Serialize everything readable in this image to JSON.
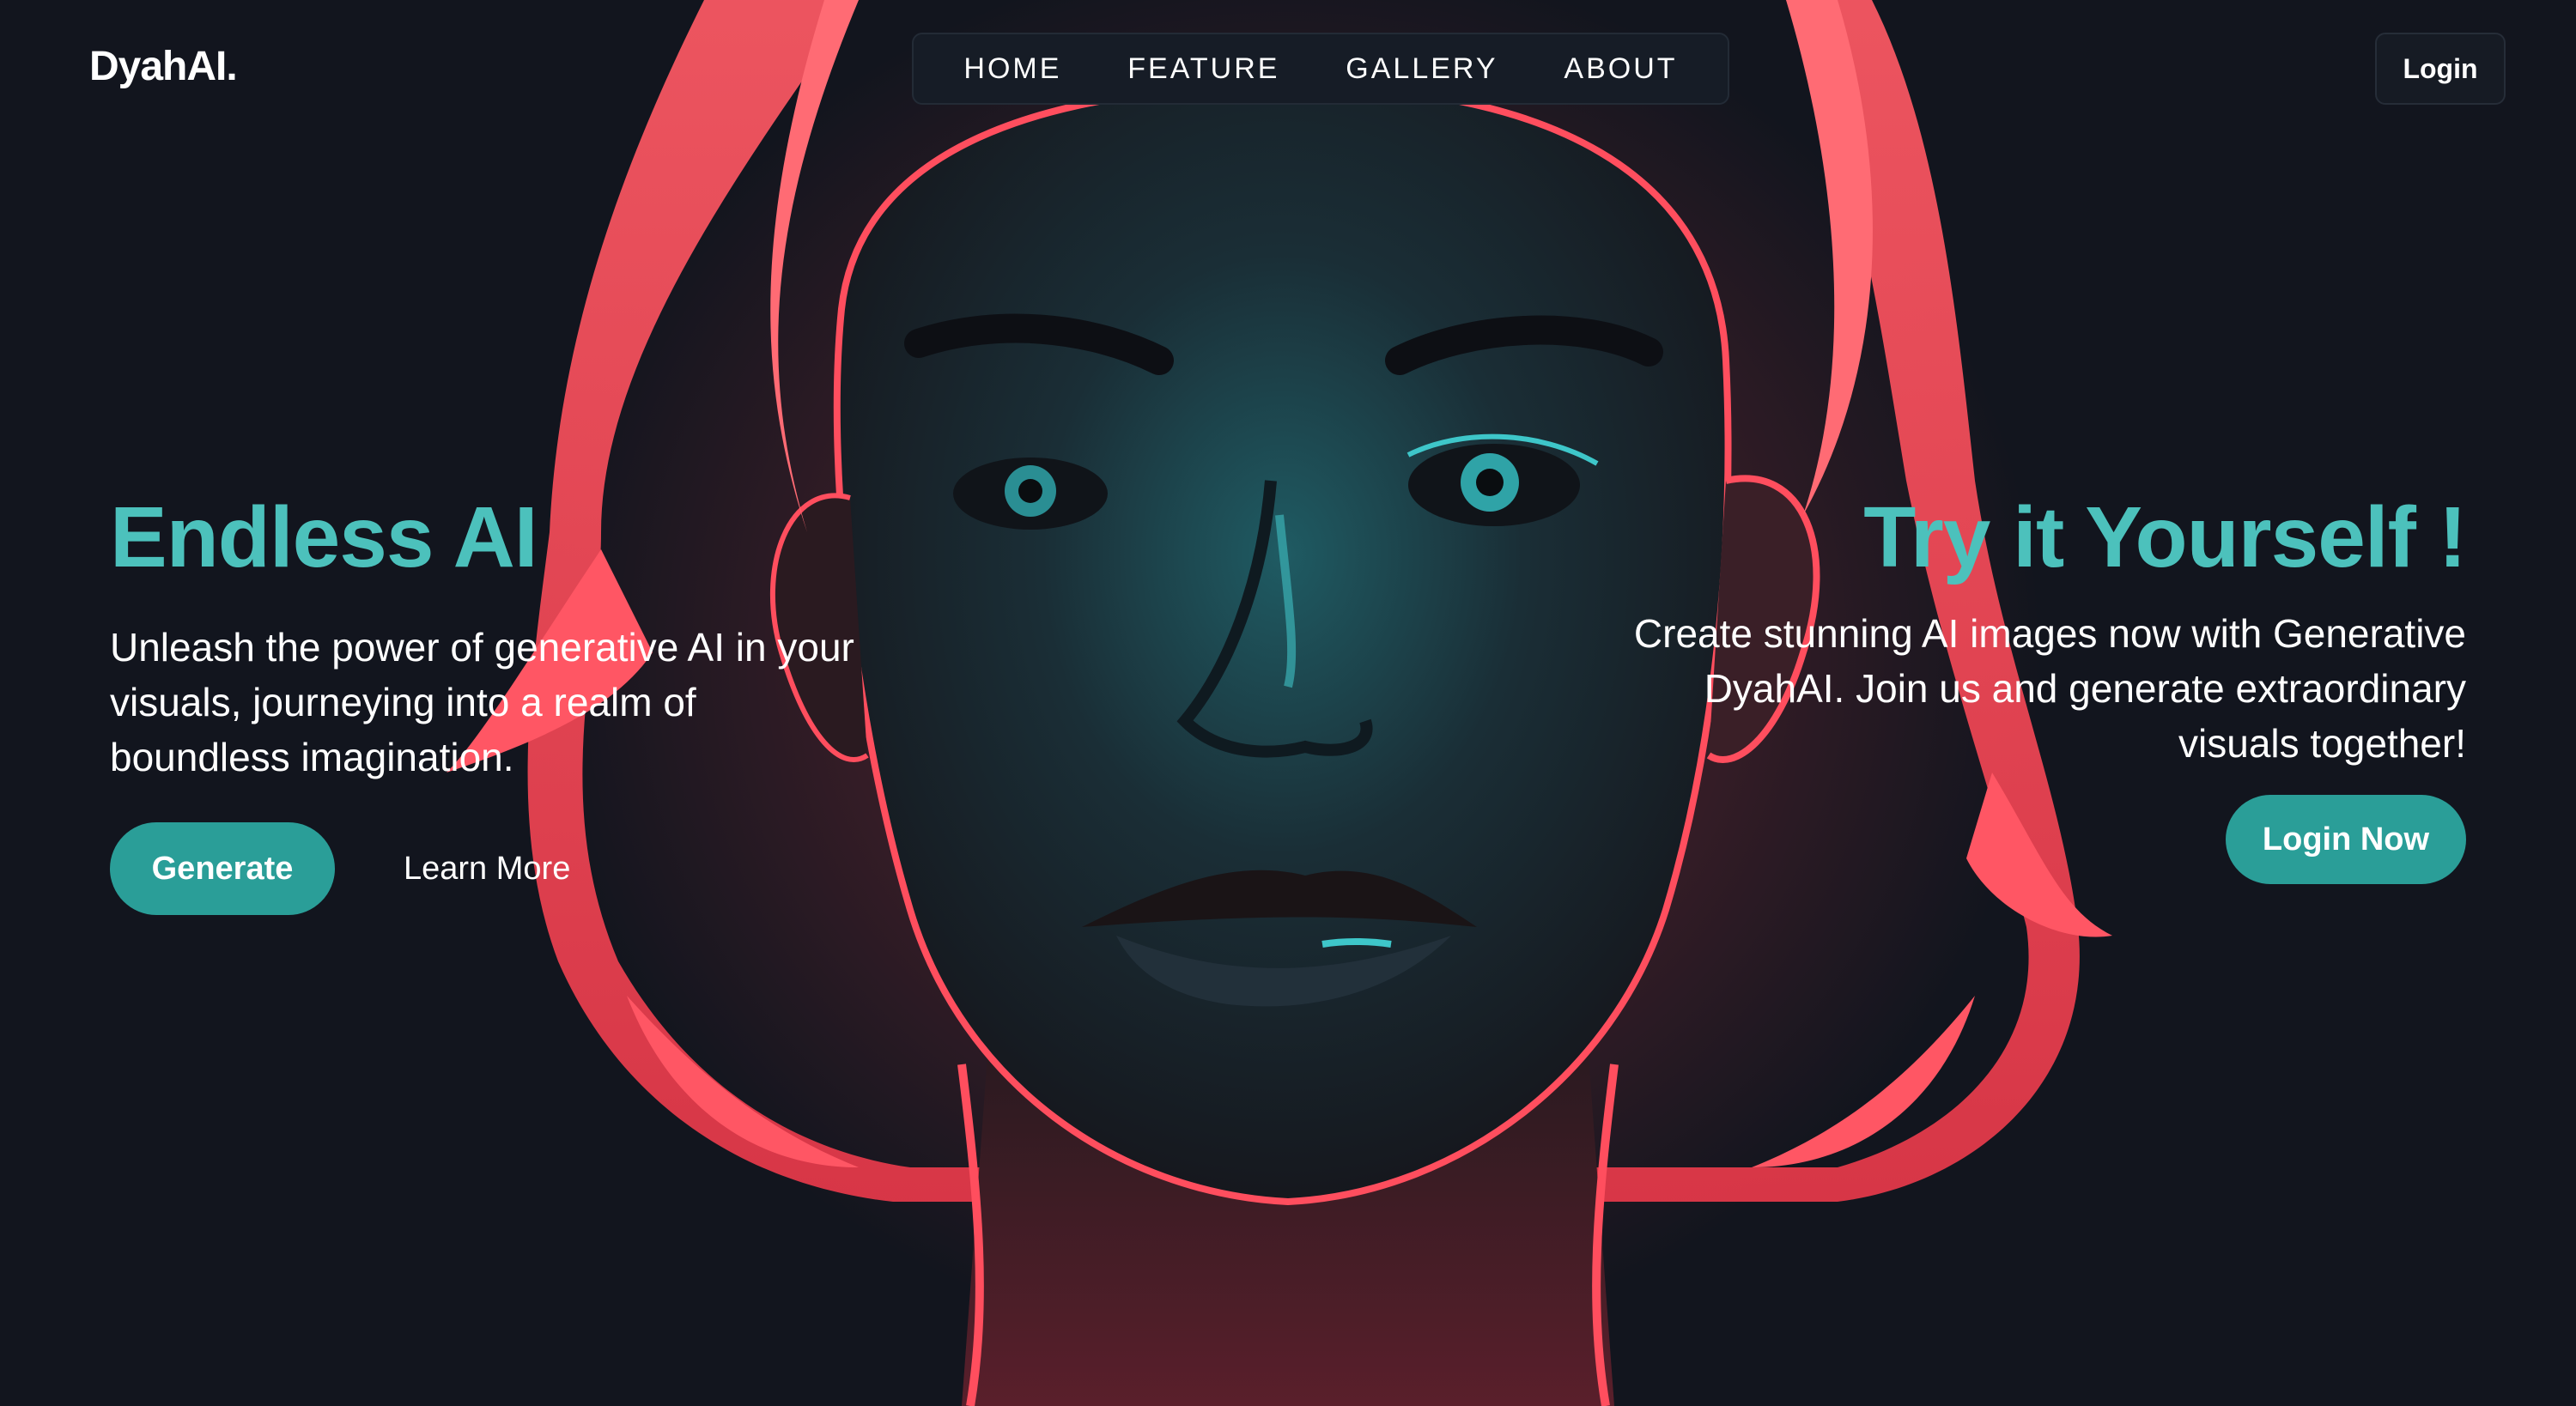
{
  "brand": {
    "logo": "DyahAI."
  },
  "nav": {
    "items": [
      {
        "label": "HOME"
      },
      {
        "label": "FEATURE"
      },
      {
        "label": "GALLERY"
      },
      {
        "label": "ABOUT"
      }
    ],
    "login_label": "Login"
  },
  "hero_left": {
    "title": "Endless AI",
    "description": "Unleash the power of generative AI in your visuals, journeying into a realm of boundless imagination.",
    "primary_button": "Generate",
    "secondary_link": "Learn More"
  },
  "hero_right": {
    "title": "Try it Yourself !",
    "description": "Create stunning AI images now with Generative DyahAI. Join us and generate extraordinary visuals together!",
    "button": "Login Now"
  },
  "colors": {
    "background": "#12151e",
    "accent": "#4cc1bc",
    "button": "#2a9e98",
    "glow_red": "#ff4655",
    "shadow_teal": "#1f5b63"
  },
  "hero_image": {
    "name": "ai-portrait-illustration"
  }
}
